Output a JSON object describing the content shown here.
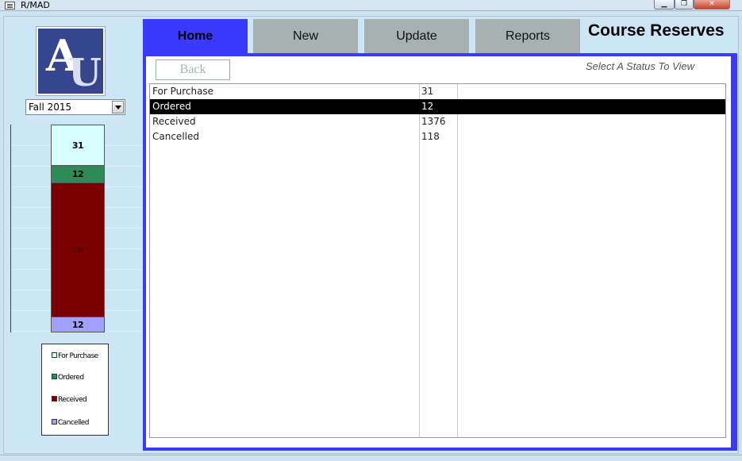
{
  "window": {
    "title": "R/MAD"
  },
  "logo": {
    "letter_a": "A",
    "letter_u": "U"
  },
  "semester": {
    "selected": "Fall 2015"
  },
  "tabs": [
    {
      "label": "Home",
      "active": true
    },
    {
      "label": "New",
      "active": false
    },
    {
      "label": "Update",
      "active": false
    },
    {
      "label": "Reports",
      "active": false
    }
  ],
  "app_title": "Course Reserves",
  "main": {
    "back_label": "Back",
    "hint": "Select A Status To View",
    "rows": [
      {
        "status": "For Purchase",
        "count": "31"
      },
      {
        "status": "Ordered",
        "count": "12"
      },
      {
        "status": "Received",
        "count": "1376"
      },
      {
        "status": "Cancelled",
        "count": "118"
      }
    ],
    "selected_row": 1
  },
  "chart_data": {
    "type": "bar",
    "stacked": true,
    "categories": [
      "For Purchase",
      "Ordered",
      "Received",
      "Cancelled"
    ],
    "series": [
      {
        "name": "For Purchase",
        "value_label": "31",
        "color": "#d6ffff"
      },
      {
        "name": "Ordered",
        "value_label": "12",
        "color": "#2e8b57"
      },
      {
        "name": "Received",
        "value_label": "100",
        "color": "#7a0000"
      },
      {
        "name": "Cancelled",
        "value_label": "12",
        "color": "#a0a0ff"
      }
    ],
    "legend": [
      "For Purchase",
      "Ordered",
      "Received",
      "Cancelled"
    ],
    "legend_position": "bottom",
    "grid": true
  },
  "colors": {
    "accent": "#3a3aff",
    "tab_inactive": "#a8b1b1",
    "selection": "#000000"
  }
}
